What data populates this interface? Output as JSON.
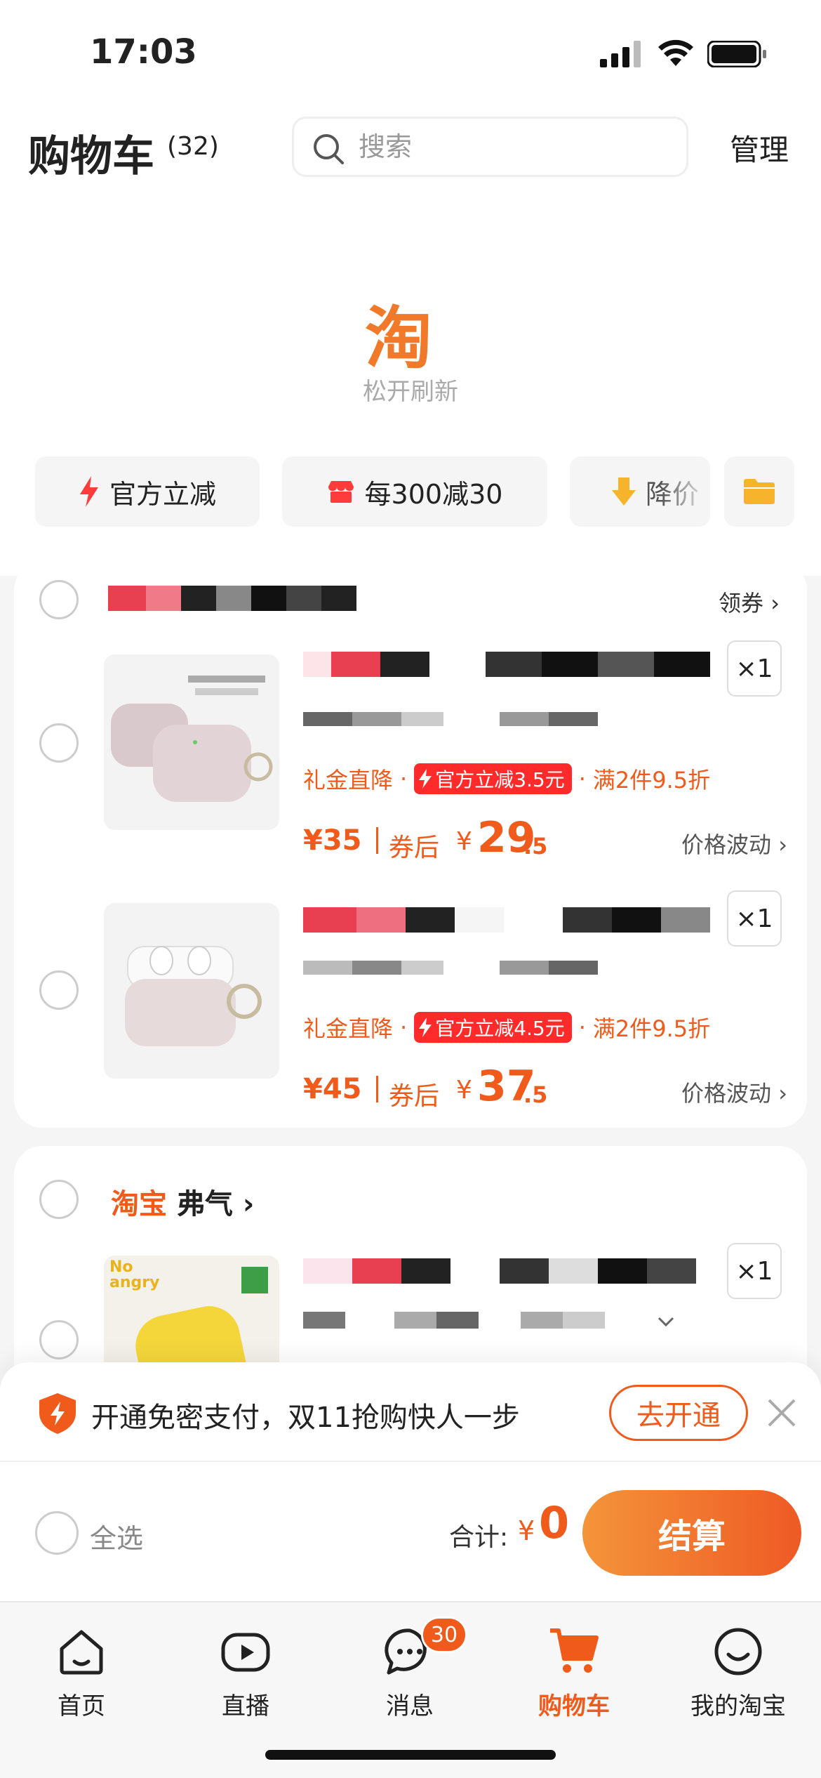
{
  "status_bar": {
    "time": "17:03"
  },
  "header": {
    "title": "购物车",
    "count": "(32)",
    "search_placeholder": "搜索",
    "manage": "管理"
  },
  "refresh": {
    "logo": "淘",
    "text": "松开刷新"
  },
  "chips": [
    {
      "label": "官方立减",
      "icon": "lightning-icon"
    },
    {
      "label": "每300减30",
      "icon": "store-icon"
    },
    {
      "label": "降价",
      "icon": "arrow-down-icon"
    },
    {
      "label": "",
      "icon": "folder-icon"
    }
  ],
  "store1": {
    "coupon": "领券",
    "items": [
      {
        "promo_gift": "礼金直降",
        "promo_tag": "官方立减3.5元",
        "promo_discount": "满2件9.5折",
        "qty": "×1",
        "price": "¥35",
        "after_label": "券后",
        "after_yen": "¥",
        "after_int": "29",
        "after_dec": ".5",
        "wave": "价格波动"
      },
      {
        "promo_gift": "礼金直降",
        "promo_tag": "官方立减4.5元",
        "promo_discount": "满2件9.5折",
        "qty": "×1",
        "price": "¥45",
        "after_label": "券后",
        "after_yen": "¥",
        "after_int": "37",
        "after_dec": ".5",
        "wave": "价格波动"
      }
    ]
  },
  "store2": {
    "brand": "淘宝",
    "name": "弗气",
    "qty": "×1",
    "image_text": "No angry"
  },
  "banner": {
    "text": "开通免密支付，双11抢购快人一步",
    "button": "去开通"
  },
  "checkout": {
    "select_all": "全选",
    "total_label": "合计:",
    "total_yen": "¥",
    "total_value": "0",
    "pay": "结算"
  },
  "tabs": [
    {
      "label": "首页",
      "icon": "home-icon"
    },
    {
      "label": "直播",
      "icon": "play-icon"
    },
    {
      "label": "消息",
      "icon": "message-icon",
      "badge": "30"
    },
    {
      "label": "购物车",
      "icon": "cart-icon",
      "active": true
    },
    {
      "label": "我的淘宝",
      "icon": "smile-icon"
    }
  ],
  "colors": {
    "accent": "#f05a1a",
    "logo": "#f07a2a",
    "tag_red": "#ff2b2b"
  }
}
